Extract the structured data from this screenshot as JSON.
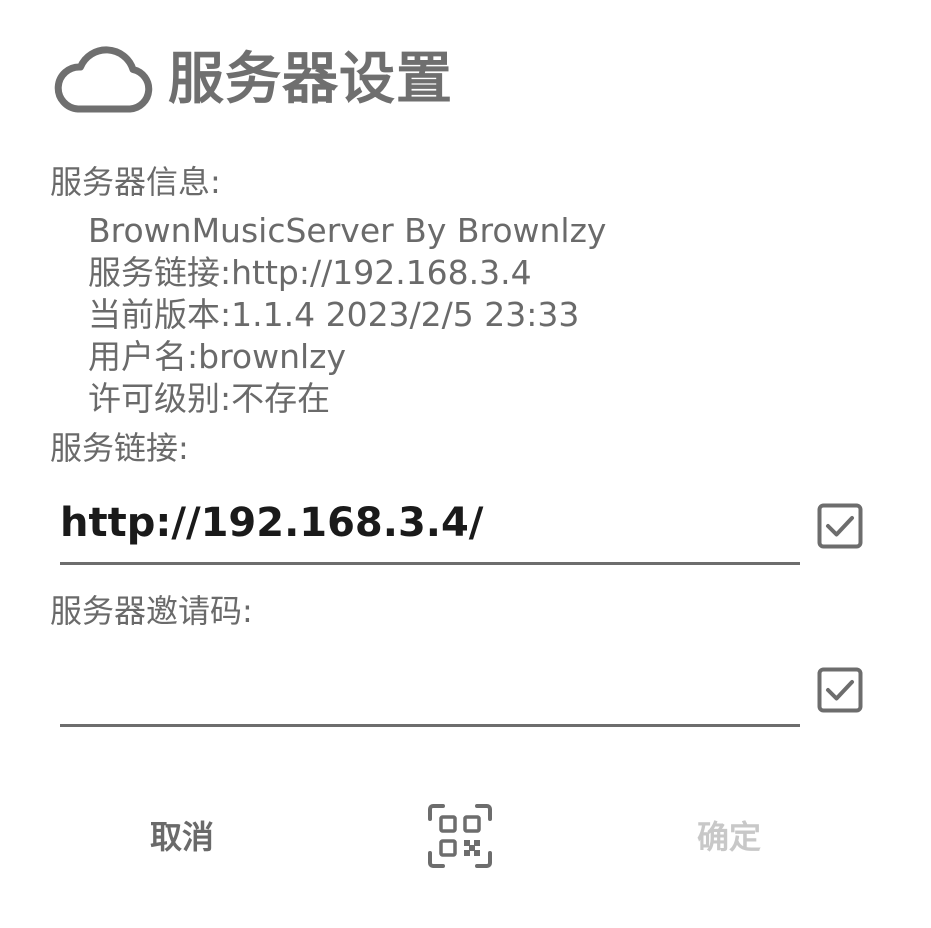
{
  "dialog": {
    "title": "服务器设置",
    "icon": "cloud-icon"
  },
  "server_info": {
    "label": "服务器信息:",
    "lines": [
      "BrownMusicServer By Brownlzy",
      "服务链接:http://192.168.3.4",
      "当前版本:1.1.4 2023/2/5 23:33",
      "用户名:brownlzy",
      "许可级别:不存在"
    ]
  },
  "server_link": {
    "label": "服务链接:",
    "value": "http://192.168.3.4/",
    "checked": true
  },
  "invite_code": {
    "label": "服务器邀请码:",
    "value": "",
    "checked": true
  },
  "buttons": {
    "cancel": "取消",
    "scan": "qr-code-scan-icon",
    "confirm": "确定"
  },
  "colors": {
    "text": "#6a6a6a",
    "input_text": "#1a1a1a",
    "disabled": "#c8c8c8",
    "underline": "#6d6d6d"
  }
}
